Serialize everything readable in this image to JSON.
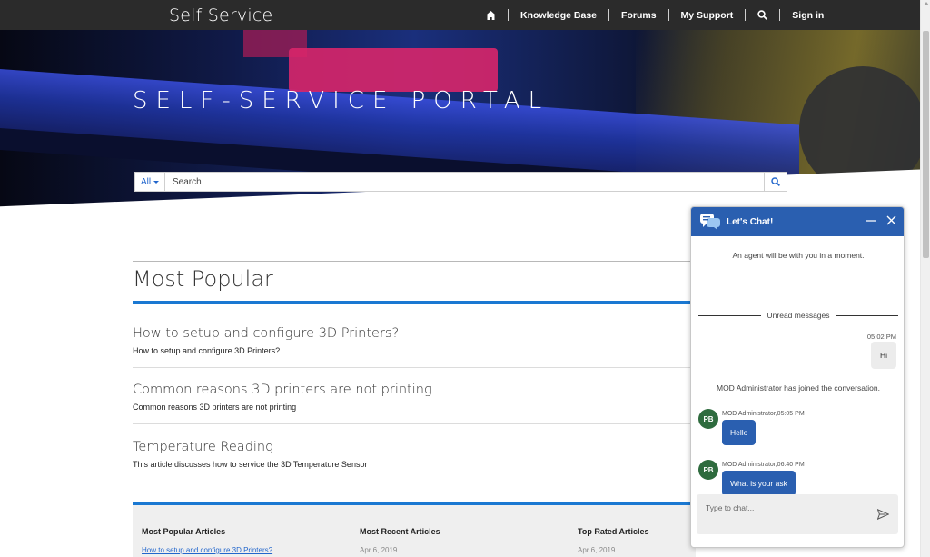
{
  "nav": {
    "brand": "Self Service",
    "items": [
      {
        "label": "Knowledge Base"
      },
      {
        "label": "Forums"
      },
      {
        "label": "My Support"
      },
      {
        "label": "Sign in"
      }
    ],
    "home_icon": "home-icon",
    "search_icon": "search-icon"
  },
  "hero": {
    "title": "SELF-SERVICE PORTAL"
  },
  "search": {
    "scope": "All",
    "placeholder": "Search"
  },
  "popular": {
    "title": "Most Popular",
    "articles": [
      {
        "title": "How to setup and configure 3D Printers?",
        "desc": "How to setup and configure 3D Printers?"
      },
      {
        "title": "Common reasons 3D printers are not printing",
        "desc": "Common reasons 3D printers are not printing"
      },
      {
        "title": "Temperature Reading",
        "desc": "This article discusses how to service the 3D Temperature Sensor"
      }
    ]
  },
  "footer": {
    "columns": [
      {
        "head": "Most Popular Articles",
        "item": "How to setup and configure 3D Printers?"
      },
      {
        "head": "Most Recent Articles",
        "item": "Apr 6, 2019"
      },
      {
        "head": "Top Rated Articles",
        "item": "Apr 6, 2019"
      }
    ]
  },
  "chat": {
    "title": "Let's Chat!",
    "agent_waiting": "An agent will be with you in a moment.",
    "unread": "Unread messages",
    "user_time": "05:02 PM",
    "user_msg": "Hi",
    "joined": "MOD Administrator has joined the conversation.",
    "agent_initials": "PB",
    "agent_msgs": [
      {
        "meta": "MOD Administrator,05:05 PM",
        "text": "Hello"
      },
      {
        "meta": "MOD Administrator,06:40 PM",
        "text": "What is your ask"
      }
    ],
    "input_placeholder": "Type to chat..."
  },
  "colors": {
    "nav_bg": "#2b2b2b",
    "accent": "#1a78d2",
    "chat_blue": "#2a5fb0",
    "avatar_green": "#2e6b3e"
  }
}
